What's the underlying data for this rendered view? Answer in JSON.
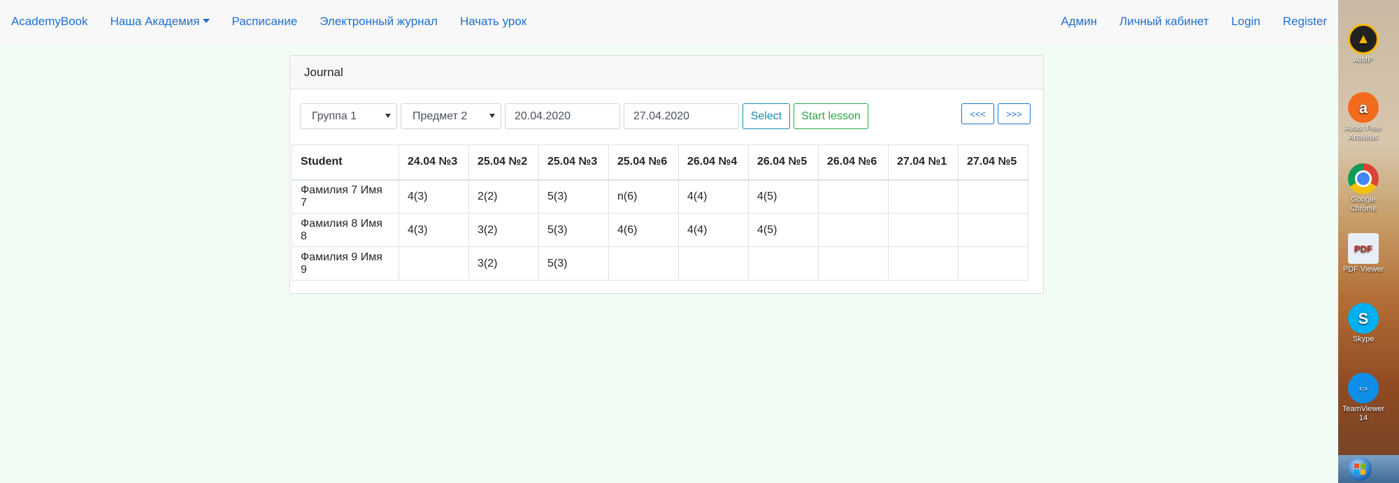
{
  "navbar": {
    "brand": "AcademyBook",
    "left": [
      "Наша Академия",
      "Расписание",
      "Электронный журнал",
      "Начать урок"
    ],
    "right": [
      "Админ",
      "Личный кабинет",
      "Login",
      "Register"
    ]
  },
  "card": {
    "title": "Journal",
    "group_select": "Группа 1",
    "subject_select": "Предмет 2",
    "date_from": "20.04.2020",
    "date_to": "27.04.2020",
    "select_button": "Select",
    "start_lesson_button": "Start lesson",
    "prev_button": "<<<",
    "next_button": ">>>"
  },
  "table": {
    "headers": [
      "Student",
      "24.04 №3",
      "25.04 №2",
      "25.04 №3",
      "25.04 №6",
      "26.04 №4",
      "26.04 №5",
      "26.04 №6",
      "27.04 №1",
      "27.04 №5"
    ],
    "rows": [
      [
        "Фамилия 7 Имя 7",
        "4(3)",
        "2(2)",
        "5(3)",
        "n(6)",
        "4(4)",
        "4(5)",
        "",
        "",
        ""
      ],
      [
        "Фамилия 8 Имя 8",
        "4(3)",
        "3(2)",
        "5(3)",
        "4(6)",
        "4(4)",
        "4(5)",
        "",
        "",
        ""
      ],
      [
        "Фамилия 9 Имя 9",
        "",
        "3(2)",
        "5(3)",
        "",
        "",
        "",
        "",
        "",
        ""
      ]
    ]
  },
  "desktop": {
    "icons": [
      "AIMP",
      "Avast Free Antivirus",
      "Google Chrome",
      "PDF Viewer",
      "Skype",
      "TeamViewer 14"
    ]
  },
  "colors": {
    "link": "#1f6fd1",
    "success": "#28a745",
    "info": "#1a8ab0",
    "page_bg": "#f1fcf4"
  }
}
